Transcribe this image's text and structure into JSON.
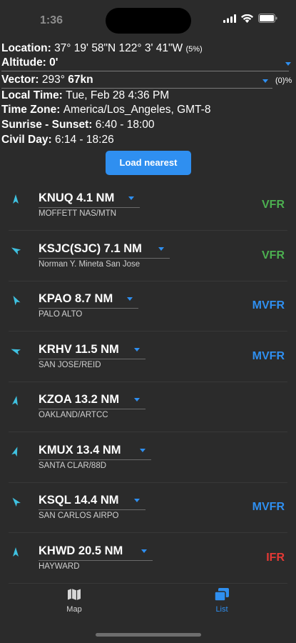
{
  "status": {
    "time": "1:36"
  },
  "info": {
    "location_label": "Location:",
    "location_value": "37° 19' 58\"N 122° 3' 41\"W",
    "location_pct": "(5%)",
    "altitude_label": "Altitude:",
    "altitude_value": "0'",
    "vector_label": "Vector:",
    "vector_value": "293°",
    "vector_speed": "67kn",
    "vector_pct": "(0)%",
    "local_time_label": "Local Time:",
    "local_time_value": "Tue, Feb 28 4:36 PM",
    "time_zone_label": "Time Zone:",
    "time_zone_value": "America/Los_Angeles, GMT-8",
    "sunrise_label": "Sunrise - Sunset:",
    "sunrise_value": "6:40 - 18:00",
    "civil_label": "Civil Day:",
    "civil_value": "6:14 - 18:26"
  },
  "load_button": "Load nearest",
  "stations": [
    {
      "title": "KNUQ 4.1 NM",
      "name": "MOFFETT NAS/MTN",
      "category": "VFR",
      "color": "#4caf50",
      "wind_deg": 0
    },
    {
      "title": "KSJC(SJC) 7.1 NM",
      "name": "Norman Y. Mineta San Jose",
      "category": "VFR",
      "color": "#4caf50",
      "wind_deg": 300
    },
    {
      "title": "KPAO 8.7 NM",
      "name": "PALO ALTO",
      "category": "MVFR",
      "color": "#2f8ff0",
      "wind_deg": 330
    },
    {
      "title": "KRHV 11.5 NM",
      "name": "SAN JOSE/REID",
      "category": "MVFR",
      "color": "#2f8ff0",
      "wind_deg": 290
    },
    {
      "title": "KZOA 13.2 NM",
      "name": "OAKLAND/ARTCC",
      "category": "",
      "color": "#ffffff",
      "wind_deg": 10
    },
    {
      "title": "KMUX 13.4 NM",
      "name": "SANTA CLAR/88D",
      "category": "",
      "color": "#ffffff",
      "wind_deg": 20
    },
    {
      "title": "KSQL 14.4 NM",
      "name": "SAN CARLOS AIRPO",
      "category": "MVFR",
      "color": "#2f8ff0",
      "wind_deg": 320
    },
    {
      "title": "KHWD 20.5 NM",
      "name": "HAYWARD",
      "category": "IFR",
      "color": "#e53935",
      "wind_deg": 0
    }
  ],
  "tabs": [
    {
      "label": "Map",
      "icon": "map-icon",
      "active": false
    },
    {
      "label": "List",
      "icon": "list-icon",
      "active": true
    }
  ],
  "colors": {
    "accent": "#2f8ff0",
    "background": "#2b2b2b",
    "wind": "#3fc1e0"
  }
}
